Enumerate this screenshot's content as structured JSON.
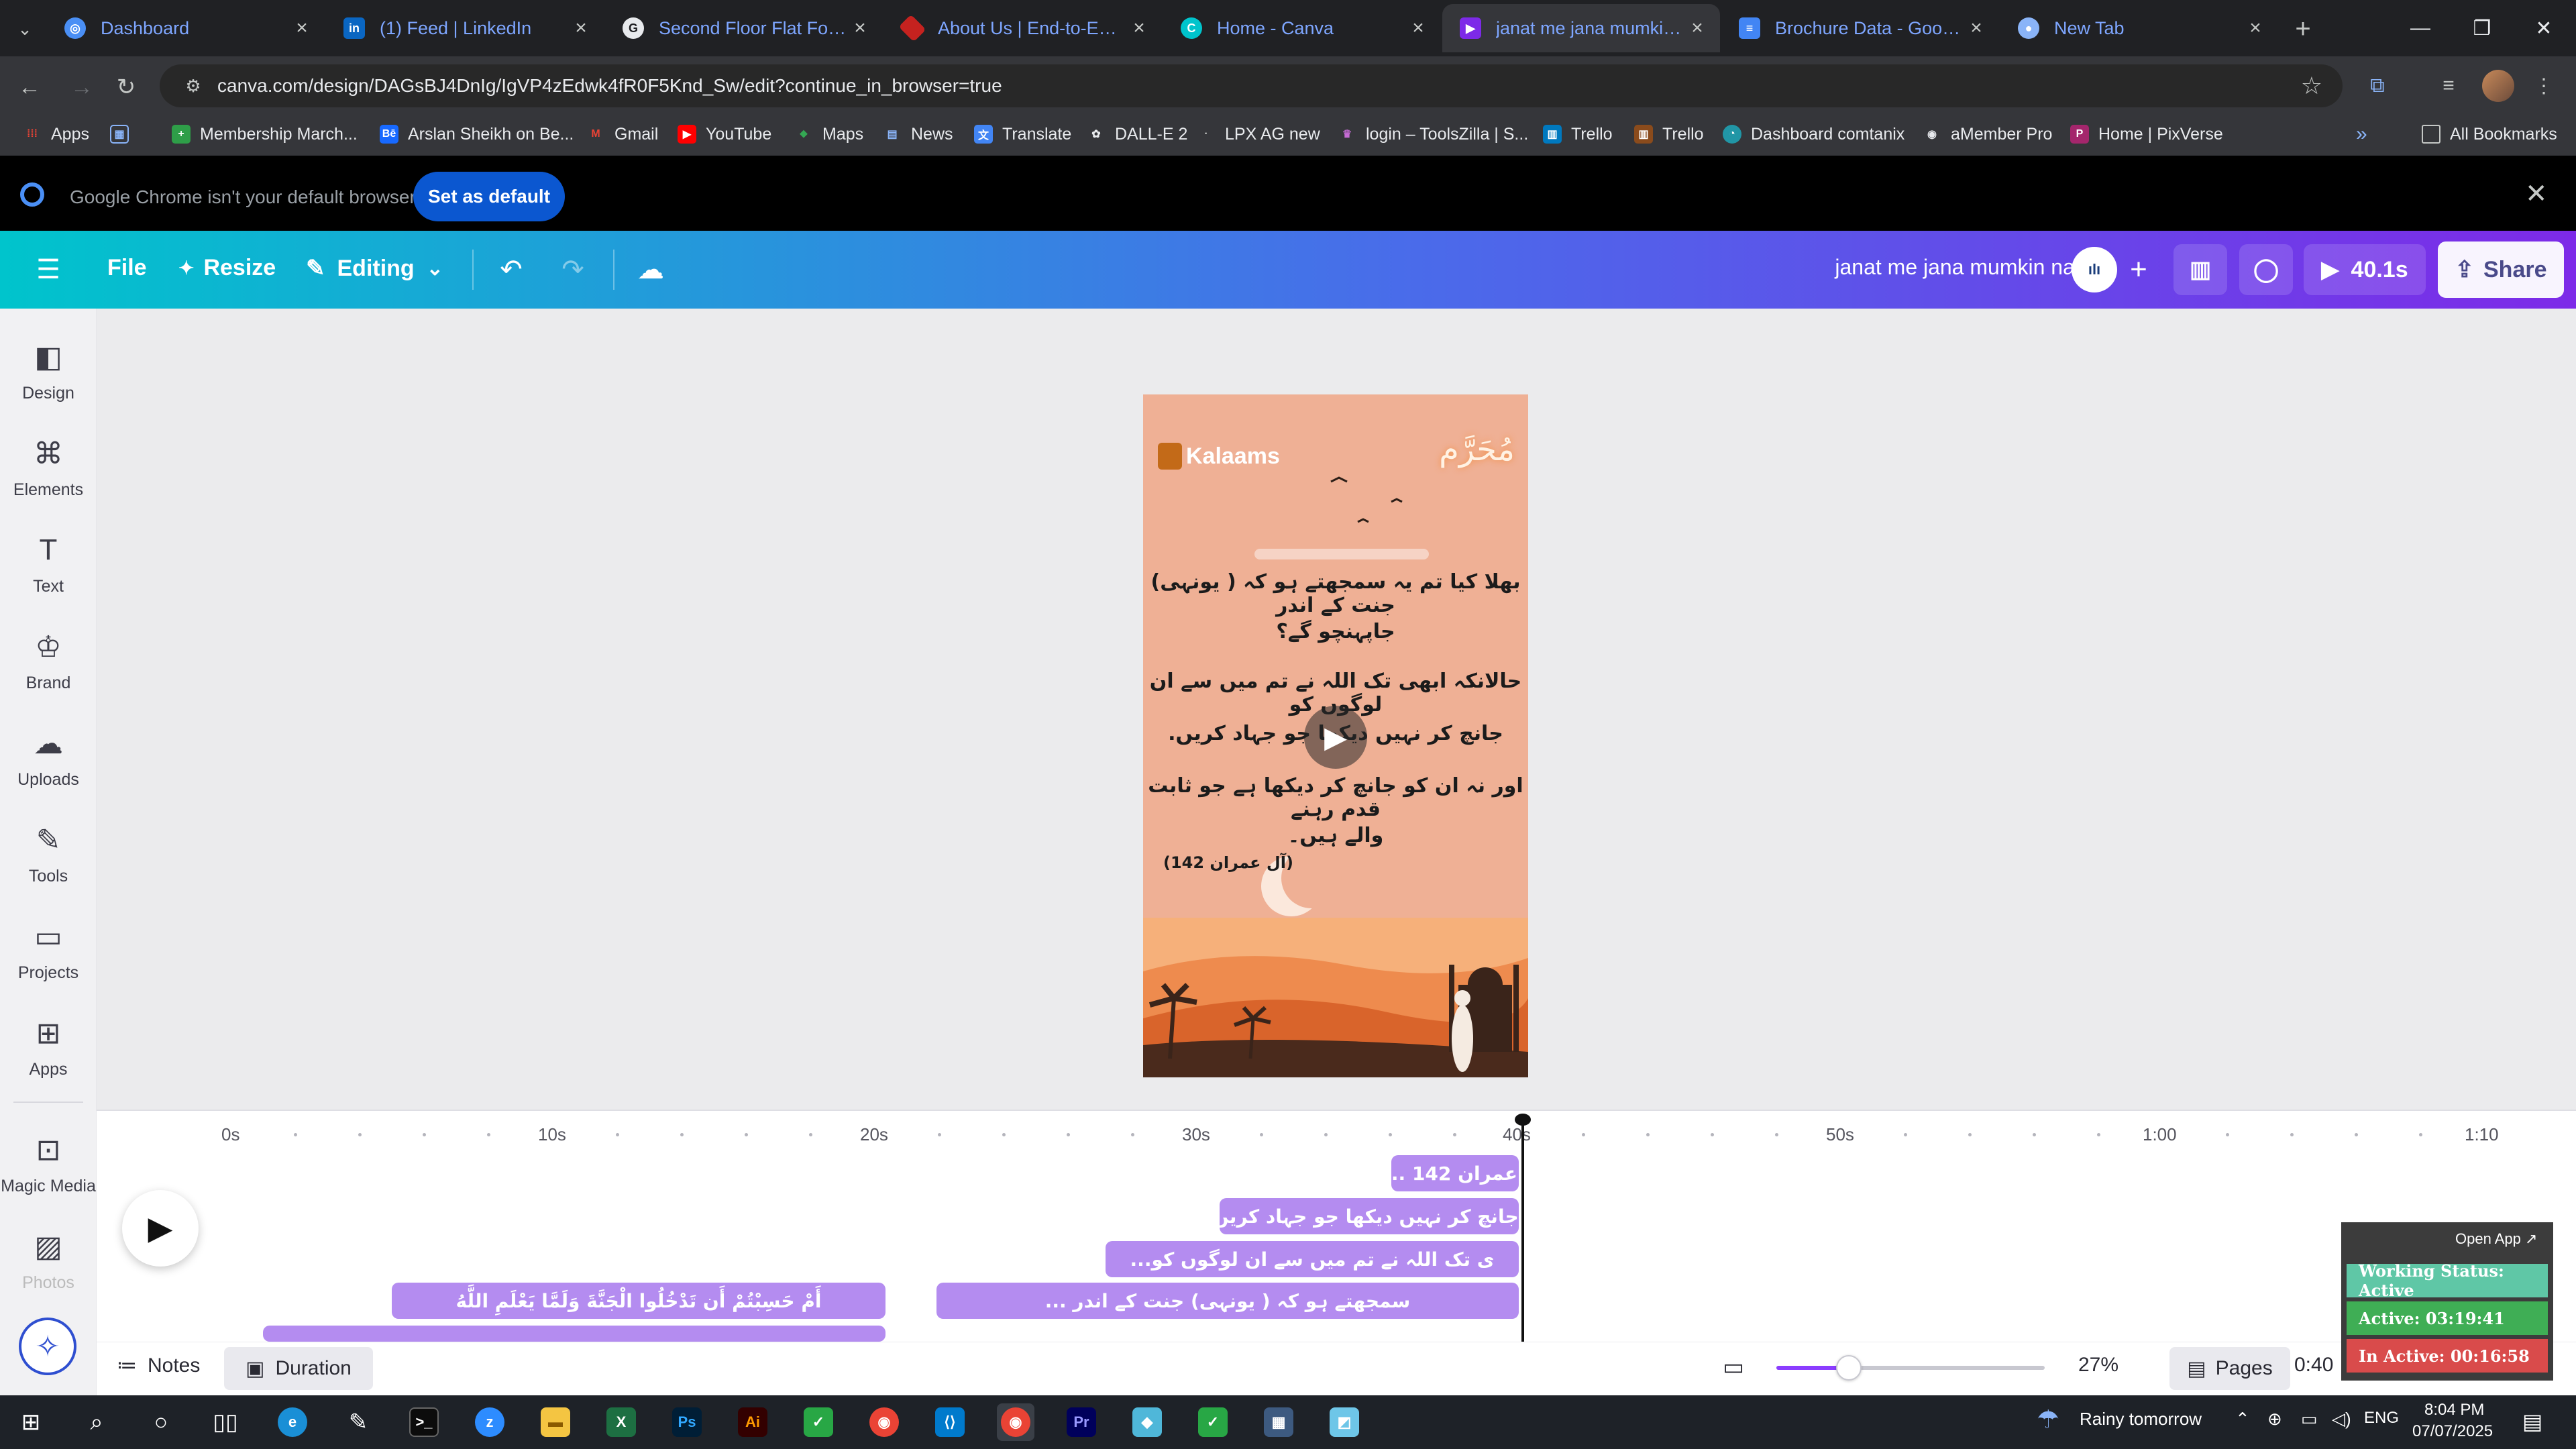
{
  "browser": {
    "tabs": [
      {
        "title": "Dashboard",
        "favicon": "globe-icon",
        "color": "#4a8ff5"
      },
      {
        "title": "(1) Feed | LinkedIn",
        "favicon": "linkedin-icon",
        "color": "#0a66c2"
      },
      {
        "title": "Second Floor Flat For Ren",
        "favicon": "site-icon",
        "color": "#e8eaed"
      },
      {
        "title": "About Us | End-to-End IT",
        "favicon": "site-icon",
        "color": "#c5221f"
      },
      {
        "title": "Home - Canva",
        "favicon": "canva-icon",
        "color": "#00c4cc"
      },
      {
        "title": "janat me jana mumkin nai",
        "favicon": "canva-video-icon",
        "color": "#7d2ae8"
      },
      {
        "title": "Brochure Data - Google D",
        "favicon": "docs-icon",
        "color": "#4285f4"
      },
      {
        "title": "New Tab",
        "favicon": "chrome-icon",
        "color": "#8ab4f8"
      }
    ],
    "url": "canva.com/design/DAGsBJ4DnIg/IgVP4zEdwk4fR0F5Knd_Sw/edit?continue_in_browser=true",
    "bookmarks": [
      {
        "label": "Apps",
        "icon": "grid-icon"
      },
      {
        "label": "",
        "icon": "apps-grid-icon"
      },
      {
        "label": "Membership March...",
        "icon": "green-plus-icon"
      },
      {
        "label": "Arslan Sheikh on Be...",
        "icon": "behance-icon"
      },
      {
        "label": "Gmail",
        "icon": "gmail-icon"
      },
      {
        "label": "YouTube",
        "icon": "youtube-icon"
      },
      {
        "label": "Maps",
        "icon": "maps-icon"
      },
      {
        "label": "News",
        "icon": "news-icon"
      },
      {
        "label": "Translate",
        "icon": "translate-icon"
      },
      {
        "label": "DALL-E 2",
        "icon": "openai-icon"
      },
      {
        "label": "LPX AG new",
        "icon": "lpx-icon"
      },
      {
        "label": "login – ToolsZilla | S...",
        "icon": "toolszilla-icon"
      },
      {
        "label": "Trello",
        "icon": "trello-icon"
      },
      {
        "label": "Trello",
        "icon": "trello-icon"
      },
      {
        "label": "Dashboard comtanix",
        "icon": "dashboard-icon"
      },
      {
        "label": "aMember Pro",
        "icon": "amember-icon"
      },
      {
        "label": "Home | PixVerse",
        "icon": "pixverse-icon"
      }
    ],
    "all_bookmarks": "All Bookmarks",
    "infobar": {
      "message": "Google Chrome isn't your default browser",
      "button": "Set as default"
    }
  },
  "canva": {
    "menu": {
      "file": "File",
      "resize": "Resize",
      "editing": "Editing"
    },
    "title": "janat me jana mumkin nai",
    "play_duration": "40.1s",
    "share": "Share",
    "sidebar": [
      {
        "label": "Design",
        "icon": "design-icon"
      },
      {
        "label": "Elements",
        "icon": "elements-icon"
      },
      {
        "label": "Text",
        "icon": "text-icon"
      },
      {
        "label": "Brand",
        "icon": "brand-icon"
      },
      {
        "label": "Uploads",
        "icon": "uploads-icon"
      },
      {
        "label": "Tools",
        "icon": "tools-icon"
      },
      {
        "label": "Projects",
        "icon": "projects-icon"
      },
      {
        "label": "Apps",
        "icon": "apps-icon"
      },
      {
        "label": "Magic Media",
        "icon": "magic-media-icon"
      },
      {
        "label": "Photos",
        "icon": "photos-icon"
      }
    ],
    "design": {
      "logo_text": "Kalaams",
      "heading_art": "مُحَرَّم",
      "lines": [
        "بھلا کیا تم یہ سمجھتے ہو کہ ( یونہی) جنت کے اندر",
        "جاپہنچو گے؟",
        "حالانکہ ابھی تک اللہ نے تم میں سے ان لوگوں کو",
        "جانچ کر نہیں دیکھا جو جہاد کریں.",
        "اور نہ ان کو جانچ کر دیکھا ہے جو ثابت قدم رہنے",
        "والے ہیں۔"
      ],
      "reference": "(آل عمران 142)"
    },
    "timeline": {
      "ticks": [
        "0s",
        "10s",
        "20s",
        "30s",
        "40s",
        "50s",
        "1:00",
        "1:10"
      ],
      "clips": [
        "... عمران 142)",
        "جانچ کر نہیں دیکھا جو جہاد کریں.",
        "...ی تک اللہ نے تم میں سے ان لوگوں کو",
        "أَمْ حَسِبْتُمْ أَن تَدْخُلُوا الْجَنَّةَ وَلَمَّا يَعْلَمِ اللَّهُ",
        "... سمجھتے ہو کہ ( یونہی) جنت کے اندر"
      ]
    },
    "bottom": {
      "notes": "Notes",
      "duration": "Duration",
      "zoom": "27%",
      "zoom_fraction": 0.27,
      "pages": "Pages",
      "time": "0:40",
      "time_total": "0:40"
    }
  },
  "tracker": {
    "open_app": "Open App ↗",
    "working_status": "Working Status: Active",
    "active": "Active: 03:19:41",
    "inactive": "In Active: 00:16:58"
  },
  "taskbar": {
    "weather": "Rainy tomorrow",
    "lang": "ENG",
    "time": "8:04 PM",
    "date": "07/07/2025"
  }
}
